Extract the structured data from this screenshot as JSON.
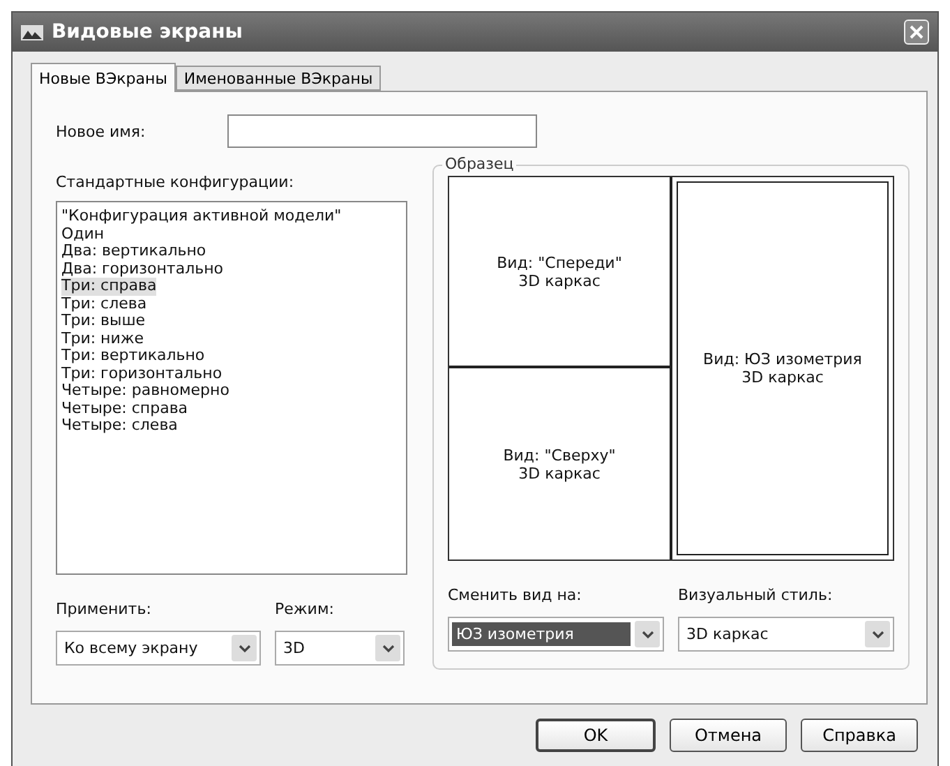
{
  "window": {
    "title": "Видовые экраны"
  },
  "tabs": [
    {
      "label": "Новые ВЭкраны",
      "selected": true
    },
    {
      "label": "Именованные ВЭкраны",
      "selected": false
    }
  ],
  "new_name": {
    "label": "Новое имя:"
  },
  "configurations": {
    "label": "Стандартные конфигурации:",
    "items": [
      {
        "label": "\"Конфигурация активной модели\"",
        "selected": false
      },
      {
        "label": "Один",
        "selected": false
      },
      {
        "label": "Два: вертикально",
        "selected": false
      },
      {
        "label": "Два: горизонтально",
        "selected": false
      },
      {
        "label": "Три: справа",
        "selected": true
      },
      {
        "label": "Три: слева",
        "selected": false
      },
      {
        "label": "Три: выше",
        "selected": false
      },
      {
        "label": "Три: ниже",
        "selected": false
      },
      {
        "label": "Три: вертикально",
        "selected": false
      },
      {
        "label": "Три: горизонтально",
        "selected": false
      },
      {
        "label": "Четыре: равномерно",
        "selected": false
      },
      {
        "label": "Четыре: справа",
        "selected": false
      },
      {
        "label": "Четыре: слева",
        "selected": false
      }
    ]
  },
  "preview": {
    "title": "Образец",
    "viewports": [
      {
        "kind": "top-left",
        "view": "Вид: \"Спереди\"",
        "style": "3D каркас",
        "selected": false
      },
      {
        "kind": "bottom-left",
        "view": "Вид: \"Сверху\"",
        "style": "3D каркас",
        "selected": false
      },
      {
        "kind": "right",
        "view": "Вид: ЮЗ изометрия",
        "style": "3D каркас",
        "selected": true
      }
    ]
  },
  "apply": {
    "label": "Применить:",
    "value": "Ко всему экрану",
    "focused": false
  },
  "mode": {
    "label": "Режим:",
    "value": "3D",
    "focused": false
  },
  "change_view": {
    "label": "Сменить вид на:",
    "value": "ЮЗ изометрия",
    "focused": true
  },
  "visual_style": {
    "label": "Визуальный стиль:",
    "value": "3D каркас",
    "focused": false
  },
  "buttons": [
    {
      "label": "OK",
      "default": true
    },
    {
      "label": "Отмена",
      "default": false
    },
    {
      "label": "Справка",
      "default": false
    }
  ]
}
